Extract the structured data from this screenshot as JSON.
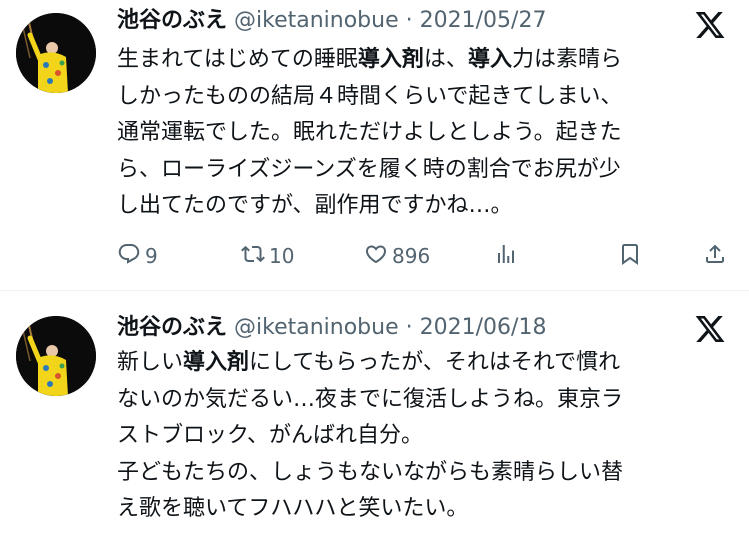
{
  "tweets": [
    {
      "name": "池谷のぶえ",
      "handle": "@iketaninobue",
      "separator": "·",
      "date": "2021/05/27",
      "lines": [
        [
          {
            "t": "生まれてはじめての睡眠"
          },
          {
            "t": "導入剤",
            "b": true
          },
          {
            "t": "は、"
          },
          {
            "t": "導入",
            "b": true
          },
          {
            "t": "力は素晴ら"
          }
        ],
        [
          {
            "t": "しかったものの結局４時間くらいで起きてしまい、"
          }
        ],
        [
          {
            "t": "通常運転でした。眠れただけよしとしよう。起きた"
          }
        ],
        [
          {
            "t": "ら、ローライズジーンズを履く時の割合でお尻が少"
          }
        ],
        [
          {
            "t": "し出てたのですが、副作用ですかね…。"
          }
        ]
      ],
      "actions": {
        "replies": "9",
        "retweets": "10",
        "likes": "896"
      }
    },
    {
      "name": "池谷のぶえ",
      "handle": "@iketaninobue",
      "separator": "·",
      "date": "2021/06/18",
      "lines": [
        [
          {
            "t": "新しい"
          },
          {
            "t": "導入剤",
            "b": true
          },
          {
            "t": "にしてもらったが、それはそれで慣れ"
          }
        ],
        [
          {
            "t": "ないのか気だるい…夜までに復活しようね。東京ラ"
          }
        ],
        [
          {
            "t": "ストブロック、がんばれ自分。"
          }
        ],
        [
          {
            "t": "子どもたちの、しょうもないながらも素晴らしい替"
          }
        ],
        [
          {
            "t": "え歌を聴いてフハハハと笑いたい。"
          }
        ]
      ]
    }
  ],
  "colors": {
    "text": "#0f1419",
    "secondary": "#536471",
    "divider": "#eff3f4",
    "avatar_outfit": "#f2d51b"
  },
  "icons": [
    "x-logo-icon",
    "reply-icon",
    "retweet-icon",
    "like-icon",
    "views-icon",
    "bookmark-icon",
    "share-icon"
  ]
}
